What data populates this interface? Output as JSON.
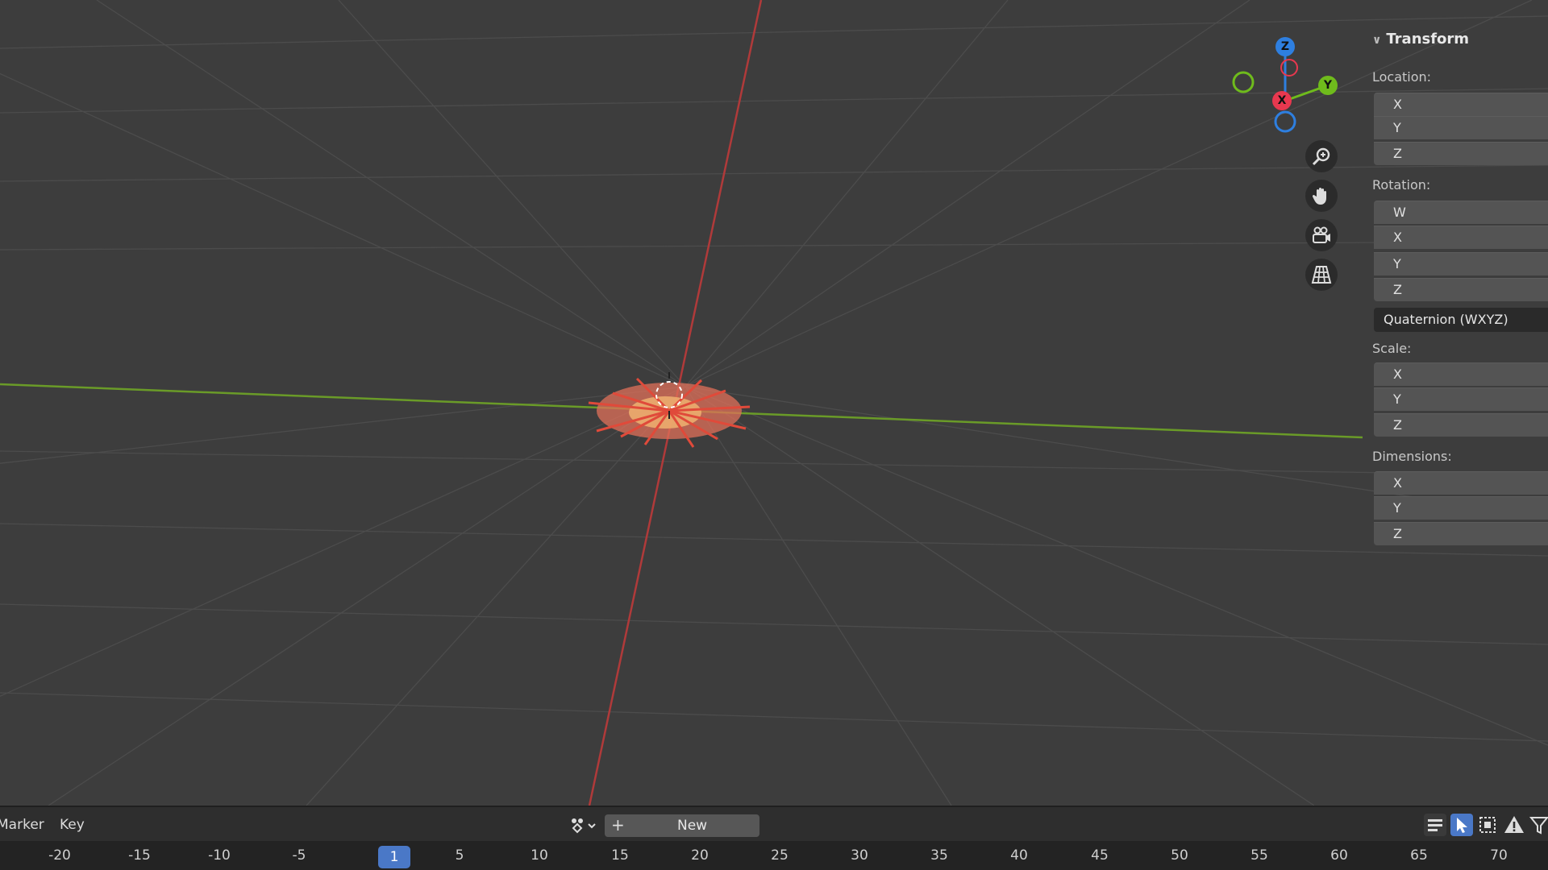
{
  "sidebar": {
    "panel_title": "Transform",
    "location_label": "Location:",
    "location_fields": [
      "X",
      "Y",
      "Z"
    ],
    "rotation_label": "Rotation:",
    "rotation_fields": [
      "W",
      "X",
      "Y",
      "Z"
    ],
    "rotation_mode": "Quaternion (WXYZ)",
    "scale_label": "Scale:",
    "scale_fields": [
      "X",
      "Y",
      "Z"
    ],
    "dimensions_label": "Dimensions:",
    "dimensions_fields": [
      "X",
      "Y",
      "Z"
    ]
  },
  "gizmo": {
    "z": "Z",
    "y": "Y",
    "x": "X",
    "colors": {
      "x": "#e8384f",
      "y": "#6fbb1c",
      "z": "#2e7fe0"
    }
  },
  "timeline": {
    "menu_marker": "Marker",
    "menu_key": "Key",
    "new_label": "New",
    "plus": "+",
    "current_frame": "1",
    "ticks": [
      "-20",
      "-15",
      "-10",
      "-5",
      "5",
      "10",
      "15",
      "20",
      "25",
      "30",
      "35",
      "40",
      "45",
      "50",
      "55",
      "60",
      "65",
      "70"
    ]
  },
  "colors": {
    "accent": "#4a78c7",
    "x_axis": "#b03a3a",
    "y_axis": "#6a9b28"
  }
}
